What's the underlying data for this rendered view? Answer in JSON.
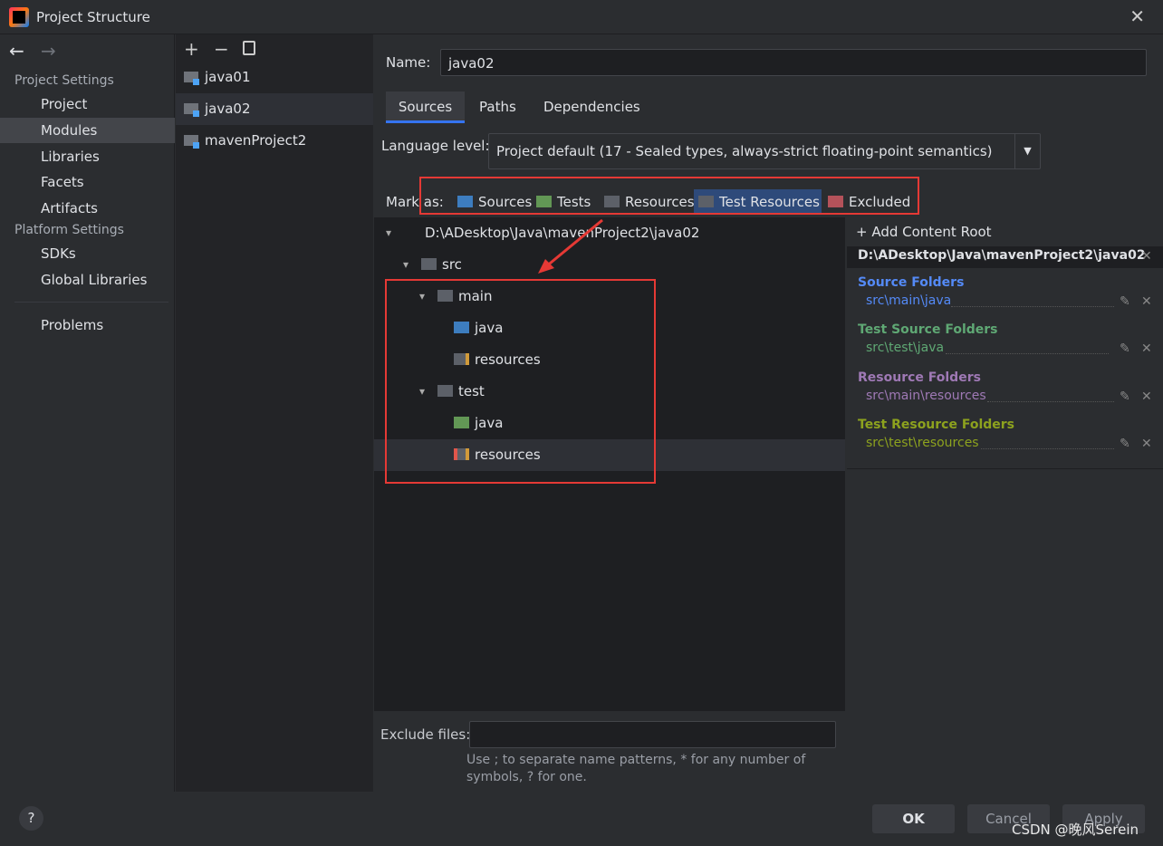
{
  "window": {
    "title": "Project Structure",
    "close": "✕"
  },
  "nav": {
    "back": "←",
    "forward": "→"
  },
  "sidebar": {
    "project_settings": "Project Settings",
    "items": [
      "Project",
      "Modules",
      "Libraries",
      "Facets",
      "Artifacts"
    ],
    "platform_settings": "Platform Settings",
    "platform_items": [
      "SDKs",
      "Global Libraries"
    ],
    "problems": "Problems",
    "selected": "Modules"
  },
  "modules": {
    "toolbar": {
      "add": "+",
      "remove": "−",
      "copy": "copy-icon"
    },
    "items": [
      "java01",
      "java02",
      "mavenProject2"
    ],
    "selected": "java02"
  },
  "name_field": {
    "label": "Name:",
    "value": "java02"
  },
  "tabs": [
    "Sources",
    "Paths",
    "Dependencies"
  ],
  "active_tab": "Sources",
  "language_level": {
    "label": "Language level:",
    "value": "Project default (17 - Sealed types, always-strict floating-point semantics)"
  },
  "mark_as": {
    "label": "Mark as:",
    "options": [
      {
        "label": "Sources",
        "color": "#3d7dbf"
      },
      {
        "label": "Tests",
        "color": "#629755"
      },
      {
        "label": "Resources",
        "color": "#5c6068"
      },
      {
        "label": "Test Resources",
        "color": "#5c6068",
        "selected": true
      },
      {
        "label": "Excluded",
        "color": "#b4525a"
      }
    ]
  },
  "tree": {
    "root": "D:\\ADesktop\\Java\\mavenProject2\\java02",
    "src": "src",
    "main": "main",
    "main_java": "java",
    "main_resources": "resources",
    "test": "test",
    "test_java": "java",
    "test_resources": "resources",
    "selected": "test/resources"
  },
  "content_root": {
    "add_label": "Add Content Root",
    "path": "D:\\ADesktop\\Java\\mavenProject2\\java02",
    "groups": [
      {
        "title": "Source Folders",
        "path": "src\\main\\java",
        "color": "#548af7"
      },
      {
        "title": "Test Source Folders",
        "path": "src\\test\\java",
        "color": "#5fa874"
      },
      {
        "title": "Resource Folders",
        "path": "src\\main\\resources",
        "color": "#9f79b5"
      },
      {
        "title": "Test Resource Folders",
        "path": "src\\test\\resources",
        "color": "#8da21e"
      }
    ]
  },
  "exclude": {
    "label": "Exclude files:",
    "value": "",
    "hint1": "Use ; to separate name patterns, * for any number of",
    "hint2": "symbols, ? for one."
  },
  "buttons": {
    "help": "?",
    "ok": "OK",
    "cancel": "Cancel",
    "apply": "Apply"
  },
  "watermark": "CSDN @晚风Serein"
}
